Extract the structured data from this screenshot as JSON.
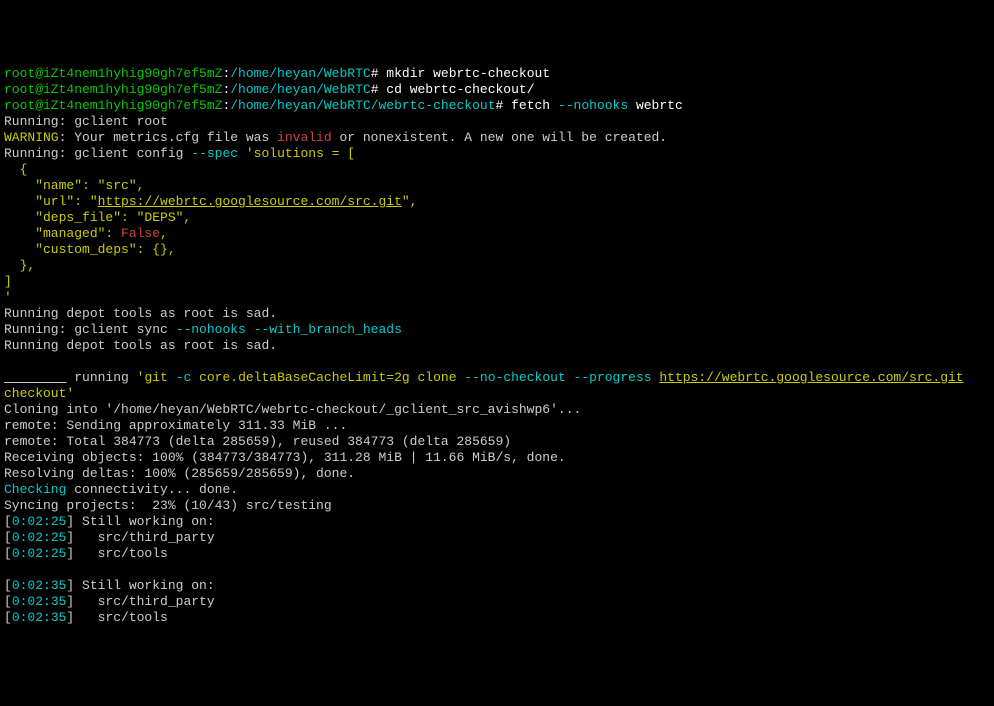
{
  "lines": [
    [
      {
        "t": "root@iZt4nem1hyhig90gh7ef5mZ",
        "c": "gr"
      },
      {
        "t": ":",
        "c": "w"
      },
      {
        "t": "/home/heyan/WebRTC",
        "c": "cy"
      },
      {
        "t": "# mkdir webrtc-checkout",
        "c": "w"
      }
    ],
    [
      {
        "t": "root@iZt4nem1hyhig90gh7ef5mZ",
        "c": "gr"
      },
      {
        "t": ":",
        "c": "w"
      },
      {
        "t": "/home/heyan/WebRTC",
        "c": "cy"
      },
      {
        "t": "# cd webrtc-checkout/",
        "c": "w"
      }
    ],
    [
      {
        "t": "root@iZt4nem1hyhig90gh7ef5mZ",
        "c": "gr"
      },
      {
        "t": ":",
        "c": "w"
      },
      {
        "t": "/home/heyan/WebRTC/webrtc-checkout",
        "c": "cy"
      },
      {
        "t": "# fetch ",
        "c": "w"
      },
      {
        "t": "--nohooks",
        "c": "cy"
      },
      {
        "t": " webrtc",
        "c": "w"
      }
    ],
    [
      {
        "t": "Running: gclient root",
        "c": ""
      }
    ],
    [
      {
        "t": "WARNING",
        "c": "y"
      },
      {
        "t": ": Your metrics.cfg file was ",
        "c": ""
      },
      {
        "t": "invalid",
        "c": "r"
      },
      {
        "t": " or nonexistent. A new one will be created.",
        "c": ""
      }
    ],
    [
      {
        "t": "Running: gclient config ",
        "c": ""
      },
      {
        "t": "--spec",
        "c": "cy"
      },
      {
        "t": " ",
        "c": ""
      },
      {
        "t": "'solutions = [",
        "c": "y"
      }
    ],
    [
      {
        "t": "  {",
        "c": "y"
      }
    ],
    [
      {
        "t": "    \"name\": \"src\",",
        "c": "y"
      }
    ],
    [
      {
        "t": "    \"url\": \"",
        "c": "y"
      },
      {
        "t": "https://webrtc.googlesource.com/src.git",
        "c": "y u"
      },
      {
        "t": "\",",
        "c": "y"
      }
    ],
    [
      {
        "t": "    \"deps_file\": \"DEPS\",",
        "c": "y"
      }
    ],
    [
      {
        "t": "    \"managed\": ",
        "c": "y"
      },
      {
        "t": "False",
        "c": "r"
      },
      {
        "t": ",",
        "c": "y"
      }
    ],
    [
      {
        "t": "    \"custom_deps\": {},",
        "c": "y"
      }
    ],
    [
      {
        "t": "  },",
        "c": "y"
      }
    ],
    [
      {
        "t": "]",
        "c": "y"
      }
    ],
    [
      {
        "t": "'",
        "c": "y"
      }
    ],
    [
      {
        "t": "Running depot tools as root is sad.",
        "c": ""
      }
    ],
    [
      {
        "t": "Running: gclient sync ",
        "c": ""
      },
      {
        "t": "--nohooks --with_branch_heads",
        "c": "cy"
      }
    ],
    [
      {
        "t": "Running depot tools as root is sad.",
        "c": ""
      }
    ],
    [
      {
        "t": " ",
        "c": ""
      }
    ],
    [
      {
        "t": "________",
        "c": "u"
      },
      {
        "t": " running ",
        "c": ""
      },
      {
        "t": "'git ",
        "c": "y"
      },
      {
        "t": "-c",
        "c": "cy"
      },
      {
        "t": " core.deltaBaseCacheLimit=2g clone ",
        "c": "y"
      },
      {
        "t": "--no-checkout --progress",
        "c": "cy"
      },
      {
        "t": " ",
        "c": ""
      },
      {
        "t": "https://webrtc.googlesource.com/src.git",
        "c": "y u"
      },
      {
        "t": " ",
        "c": ""
      }
    ],
    [
      {
        "t": "checkout'",
        "c": "y"
      }
    ],
    [
      {
        "t": "Cloning into '/home/heyan/WebRTC/webrtc-checkout/_gclient_src_avishwp6'...",
        "c": ""
      }
    ],
    [
      {
        "t": "remote: Sending approximately 311.33 MiB ...",
        "c": ""
      }
    ],
    [
      {
        "t": "remote: Total 384773 (delta 285659), reused 384773 (delta 285659)",
        "c": ""
      }
    ],
    [
      {
        "t": "Receiving objects: 100% (384773/384773), 311.28 MiB | 11.66 MiB/s, done.",
        "c": ""
      }
    ],
    [
      {
        "t": "Resolving deltas: 100% (285659/285659), done.",
        "c": ""
      }
    ],
    [
      {
        "t": "Checking",
        "c": "cy"
      },
      {
        "t": " connectivity... done.",
        "c": ""
      }
    ],
    [
      {
        "t": "Syncing projects:  23% (10/43) src/testing",
        "c": ""
      }
    ],
    [
      {
        "t": "[",
        "c": ""
      },
      {
        "t": "0:02:25",
        "c": "cy"
      },
      {
        "t": "] Still working on:",
        "c": ""
      }
    ],
    [
      {
        "t": "[",
        "c": ""
      },
      {
        "t": "0:02:25",
        "c": "cy"
      },
      {
        "t": "]   src/third_party",
        "c": ""
      }
    ],
    [
      {
        "t": "[",
        "c": ""
      },
      {
        "t": "0:02:25",
        "c": "cy"
      },
      {
        "t": "]   src/tools",
        "c": ""
      }
    ],
    [
      {
        "t": " ",
        "c": ""
      }
    ],
    [
      {
        "t": "[",
        "c": ""
      },
      {
        "t": "0:02:35",
        "c": "cy"
      },
      {
        "t": "] Still working on:",
        "c": ""
      }
    ],
    [
      {
        "t": "[",
        "c": ""
      },
      {
        "t": "0:02:35",
        "c": "cy"
      },
      {
        "t": "]   src/third_party",
        "c": ""
      }
    ],
    [
      {
        "t": "[",
        "c": ""
      },
      {
        "t": "0:02:35",
        "c": "cy"
      },
      {
        "t": "]   src/tools",
        "c": ""
      }
    ]
  ]
}
